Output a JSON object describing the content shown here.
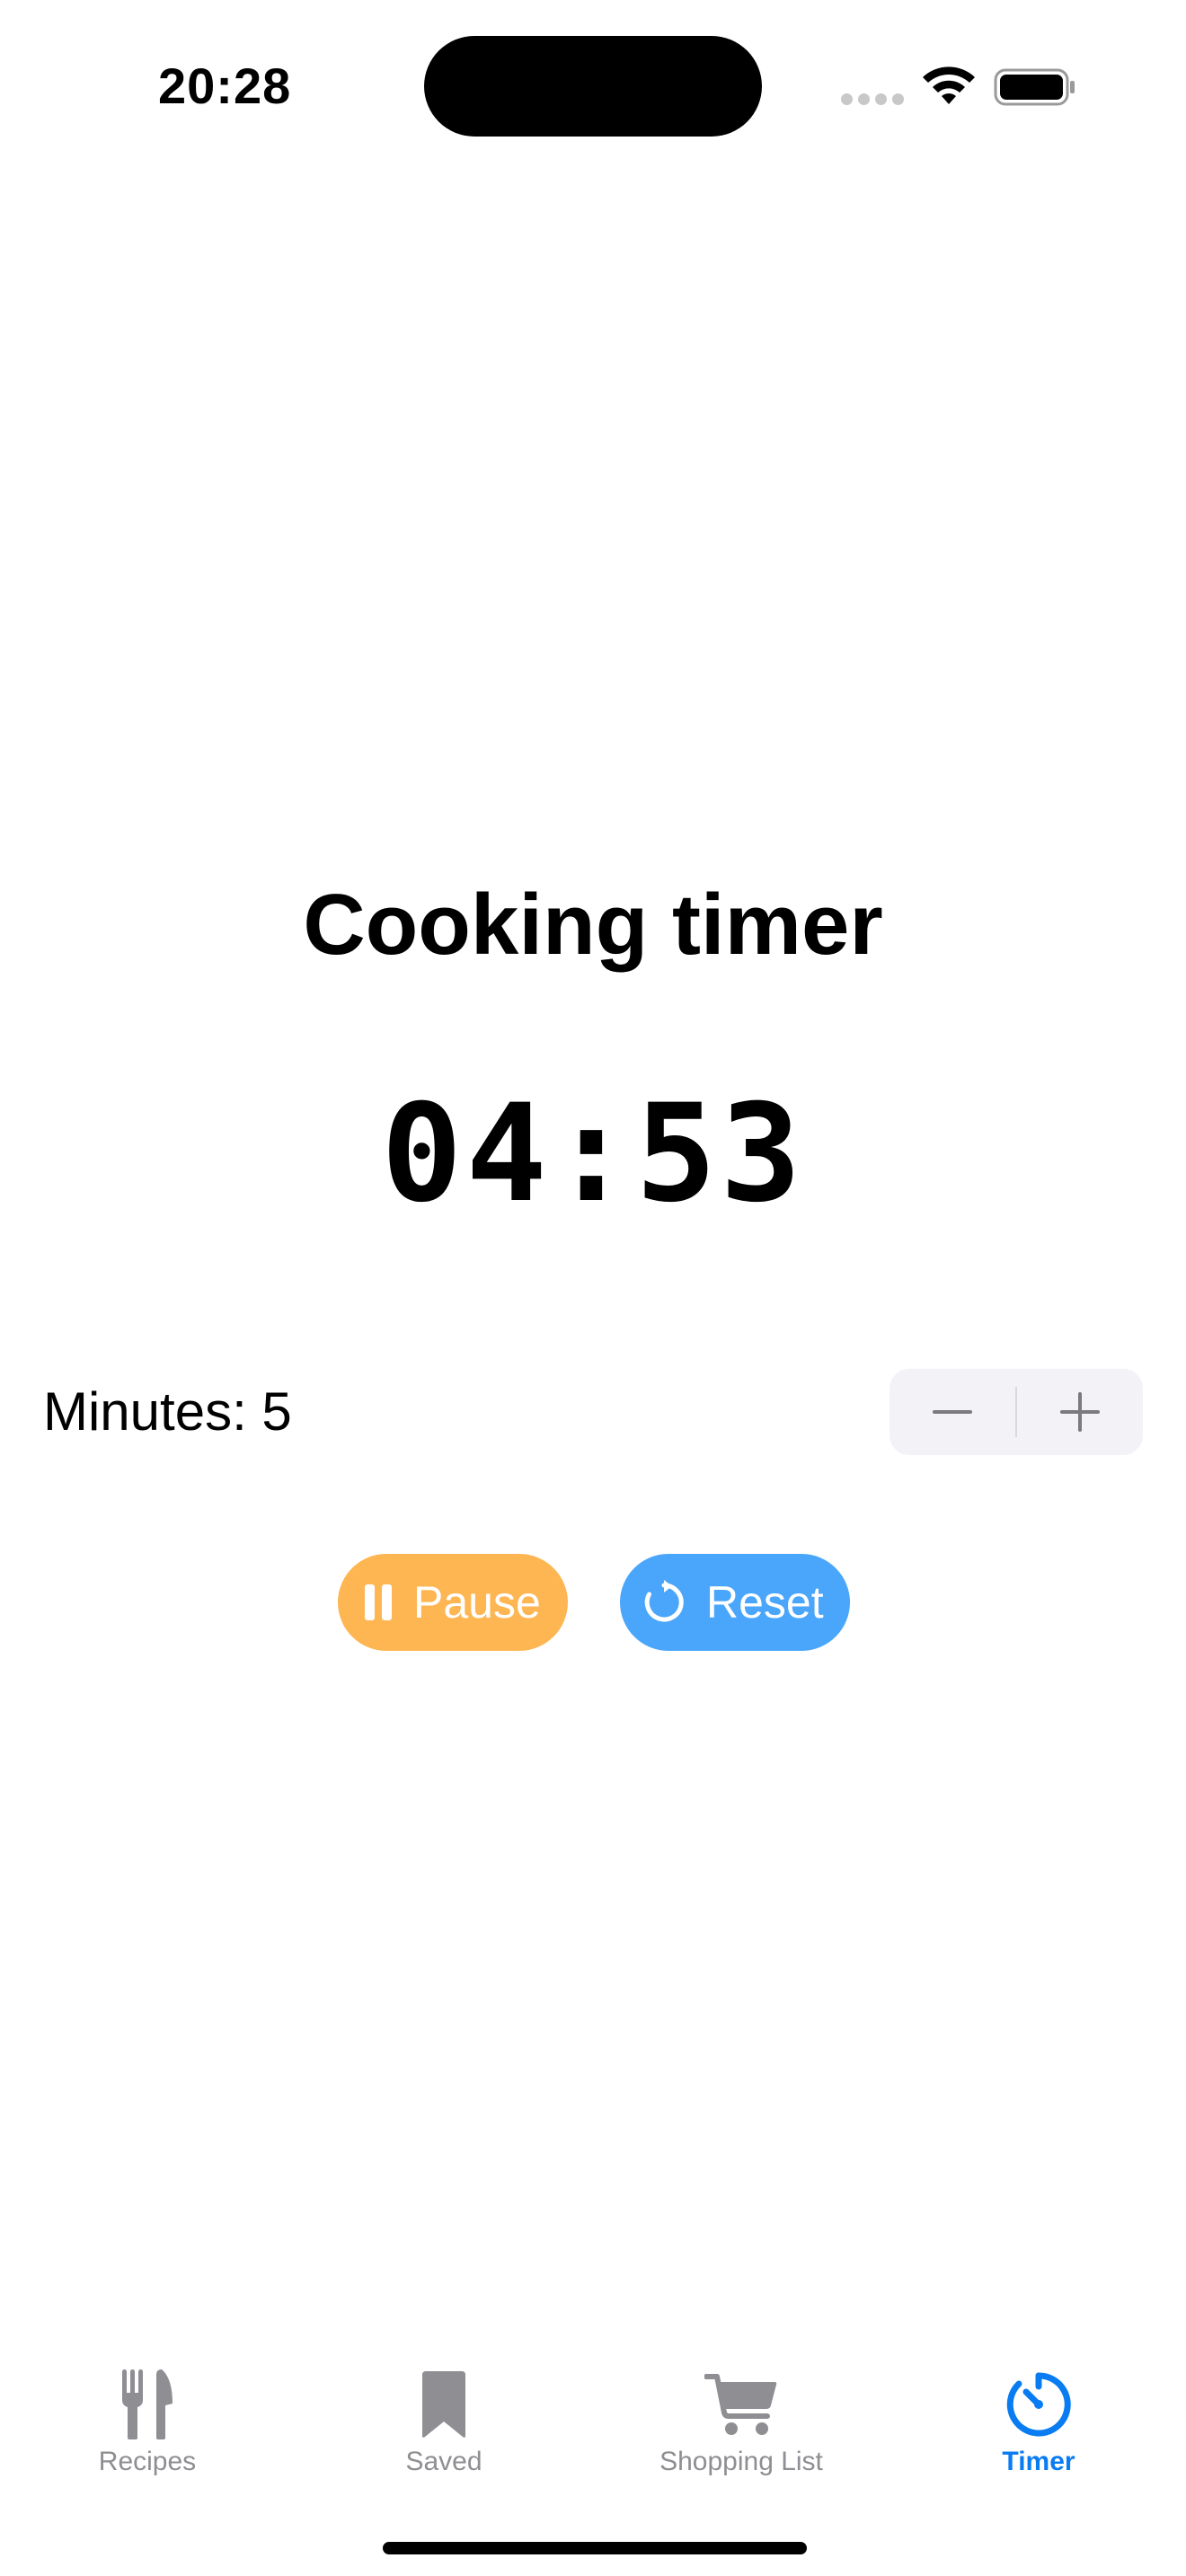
{
  "status_bar": {
    "time": "20:28"
  },
  "screen": {
    "title": "Cooking timer",
    "timer_display": "04:53",
    "minutes_label": "Minutes: 5",
    "stepper": {
      "decrement_icon": "minus-icon",
      "increment_icon": "plus-icon"
    },
    "actions": {
      "pause_label": "Pause",
      "pause_icon": "pause-icon",
      "pause_color": "#feb653",
      "reset_label": "Reset",
      "reset_icon": "reset-icon",
      "reset_color": "#4aa6fb"
    }
  },
  "tab_bar": {
    "active_color": "#0a7cf2",
    "inactive_color": "#8e8e93",
    "items": [
      {
        "label": "Recipes",
        "icon": "fork-knife-icon",
        "active": false
      },
      {
        "label": "Saved",
        "icon": "bookmark-icon",
        "active": false
      },
      {
        "label": "Shopping List",
        "icon": "cart-icon",
        "active": false
      },
      {
        "label": "Timer",
        "icon": "timer-icon",
        "active": true
      }
    ]
  }
}
